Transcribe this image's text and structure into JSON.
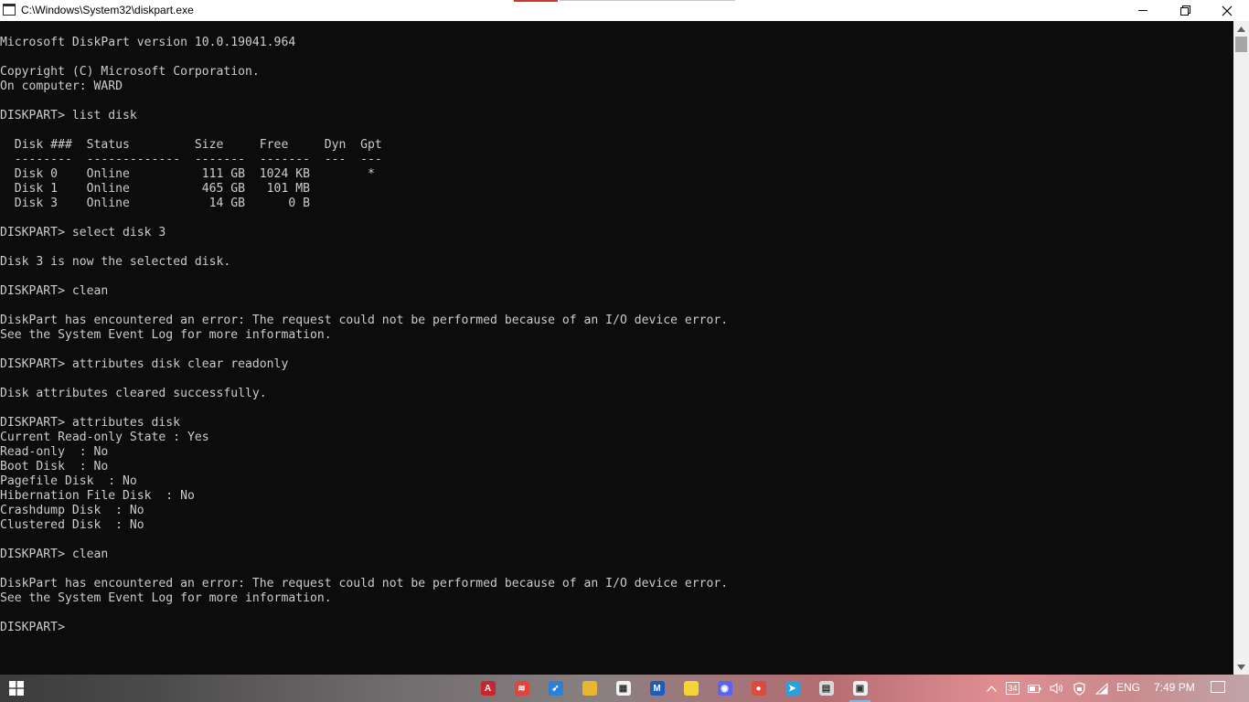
{
  "window": {
    "title": "C:\\Windows\\System32\\diskpart.exe"
  },
  "console": {
    "lines": [
      "Microsoft DiskPart version 10.0.19041.964",
      "",
      "Copyright (C) Microsoft Corporation.",
      "On computer: WARD",
      "",
      "DISKPART> list disk",
      "",
      "  Disk ###  Status         Size     Free     Dyn  Gpt",
      "  --------  -------------  -------  -------  ---  ---",
      "  Disk 0    Online          111 GB  1024 KB        *",
      "  Disk 1    Online          465 GB   101 MB",
      "  Disk 3    Online           14 GB      0 B",
      "",
      "DISKPART> select disk 3",
      "",
      "Disk 3 is now the selected disk.",
      "",
      "DISKPART> clean",
      "",
      "DiskPart has encountered an error: The request could not be performed because of an I/O device error.",
      "See the System Event Log for more information.",
      "",
      "DISKPART> attributes disk clear readonly",
      "",
      "Disk attributes cleared successfully.",
      "",
      "DISKPART> attributes disk",
      "Current Read-only State : Yes",
      "Read-only  : No",
      "Boot Disk  : No",
      "Pagefile Disk  : No",
      "Hibernation File Disk  : No",
      "Crashdump Disk  : No",
      "Clustered Disk  : No",
      "",
      "DISKPART> clean",
      "",
      "DiskPart has encountered an error: The request could not be performed because of an I/O device error.",
      "See the System Event Log for more information.",
      "",
      "DISKPART> "
    ]
  },
  "taskbar": {
    "apps": [
      {
        "icon": "autocad-icon",
        "color": "#c8262c",
        "glyph": "A"
      },
      {
        "icon": "anydesk-icon",
        "color": "#e2433c",
        "glyph": "≋"
      },
      {
        "icon": "rocket-app-icon",
        "color": "#2b7fd6",
        "glyph": "➶"
      },
      {
        "icon": "file-explorer-icon",
        "color": "#e9b630",
        "glyph": ""
      },
      {
        "icon": "microsoft-store-icon",
        "color": "#f2f2f2",
        "glyph": "▦"
      },
      {
        "icon": "malwarebytes-icon",
        "color": "#1f5cb6",
        "glyph": "M"
      },
      {
        "icon": "sticky-notes-icon",
        "color": "#f7d33a",
        "glyph": ""
      },
      {
        "icon": "discord-icon",
        "color": "#5865f2",
        "glyph": "◉"
      },
      {
        "icon": "chrome-icon",
        "color": "#dd4b3e",
        "glyph": "●"
      },
      {
        "icon": "telegram-icon",
        "color": "#2aa1da",
        "glyph": "➤"
      },
      {
        "icon": "printer-icon",
        "color": "#d9d9d9",
        "glyph": "▤"
      },
      {
        "icon": "command-prompt-icon",
        "color": "#f0f0f0",
        "glyph": "▣"
      }
    ],
    "tray": {
      "badge": "34",
      "language": "ENG",
      "time": "7:49 PM"
    }
  }
}
